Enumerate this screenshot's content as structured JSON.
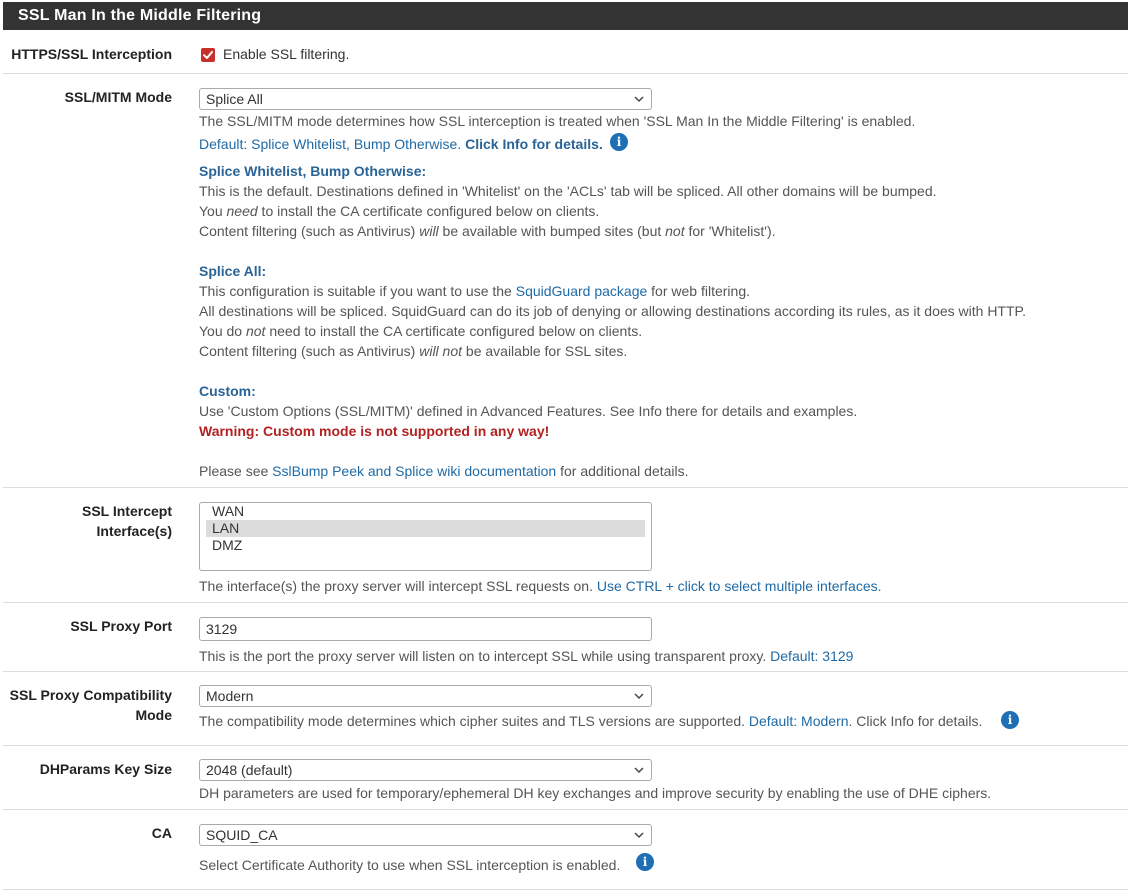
{
  "panel": {
    "title": "SSL Man In the Middle Filtering"
  },
  "https_interception": {
    "label": "HTTPS/SSL Interception",
    "checkbox_label": "Enable SSL filtering.",
    "checked": true
  },
  "ssl_mitm_mode": {
    "label": "SSL/MITM Mode",
    "selected": "Splice All",
    "help_line1": "The SSL/MITM mode determines how SSL interception is treated when 'SSL Man In the Middle Filtering' is enabled.",
    "default_text": "Default: Splice Whitelist, Bump Otherwise.",
    "click_info": "Click Info for details.",
    "splice_whitelist": {
      "heading": "Splice Whitelist, Bump Otherwise:",
      "line1": "This is the default. Destinations defined in 'Whitelist' on the 'ACLs' tab will be spliced. All other domains will be bumped.",
      "line2_pre": "You ",
      "line2_em": "need",
      "line2_post": " to install the CA certificate configured below on clients.",
      "line3_pre": "Content filtering (such as Antivirus) ",
      "line3_em": "will",
      "line3_mid": " be available with bumped sites (but ",
      "line3_em2": "not",
      "line3_post": " for 'Whitelist')."
    },
    "splice_all": {
      "heading": "Splice All:",
      "line1_pre": "This configuration is suitable if you want to use the ",
      "line1_link": "SquidGuard package",
      "line1_post": " for web filtering.",
      "line2": "All destinations will be spliced. SquidGuard can do its job of denying or allowing destinations according its rules, as it does with HTTP.",
      "line3_pre": "You do ",
      "line3_em": "not",
      "line3_post": " need to install the CA certificate configured below on clients.",
      "line4_pre": "Content filtering (such as Antivirus) ",
      "line4_em": "will not",
      "line4_post": " be available for SSL sites."
    },
    "custom": {
      "heading": "Custom:",
      "line1": "Use 'Custom Options (SSL/MITM)' defined in Advanced Features. See Info there for details and examples.",
      "warning": "Warning: Custom mode is not supported in any way!"
    },
    "footer_pre": "Please see ",
    "footer_link": "SslBump Peek and Splice wiki documentation",
    "footer_post": " for additional details."
  },
  "intercept_interfaces": {
    "label": "SSL Intercept Interface(s)",
    "options": [
      "WAN",
      "LAN",
      "DMZ"
    ],
    "selected": "LAN",
    "help_pre": "The interface(s) the proxy server will intercept SSL requests on. ",
    "help_link": "Use CTRL + click to select multiple interfaces."
  },
  "proxy_port": {
    "label": "SSL Proxy Port",
    "value": "3129",
    "help_pre": "This is the port the proxy server will listen on to intercept SSL while using transparent proxy. ",
    "help_default": "Default: 3129"
  },
  "compat_mode": {
    "label_line1": "SSL Proxy Compatibility",
    "label_line2": "Mode",
    "selected": "Modern",
    "help_pre": "The compatibility mode determines which cipher suites and TLS versions are supported. ",
    "help_default": "Default: Modern",
    "help_post": ". Click Info for details."
  },
  "dhparams": {
    "label": "DHParams Key Size",
    "selected": "2048 (default)",
    "help": "DH parameters are used for temporary/ephemeral DH key exchanges and improve security by enabling the use of DHE ciphers."
  },
  "ca": {
    "label": "CA",
    "selected": "SQUID_CA",
    "help": "Select Certificate Authority to use when SSL interception is enabled."
  },
  "icons": {
    "info": "i",
    "check": "✓"
  },
  "colors": {
    "heading_bg": "#333333",
    "link": "#1f6aa5",
    "warning": "#b22222",
    "checkbox": "#c9302c",
    "info_icon": "#1e6fb5"
  }
}
